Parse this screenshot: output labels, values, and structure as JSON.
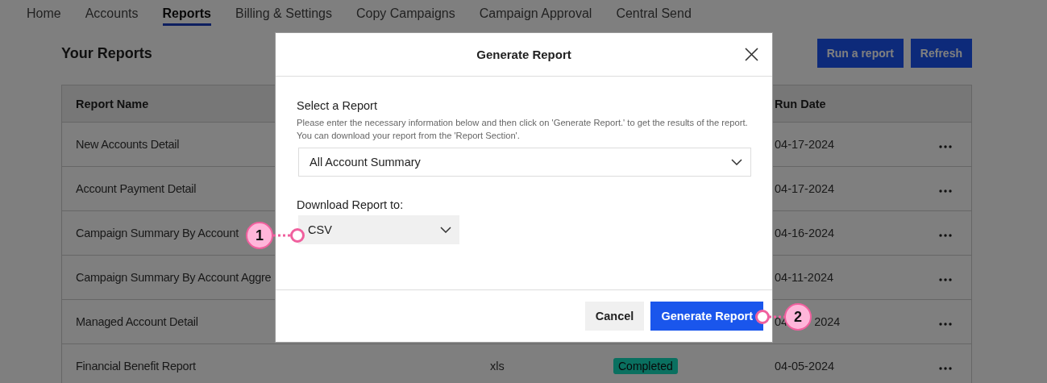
{
  "nav": {
    "tabs": [
      {
        "label": "Home",
        "selected": false
      },
      {
        "label": "Accounts",
        "selected": false
      },
      {
        "label": "Reports",
        "selected": true
      },
      {
        "label": "Billing & Settings",
        "selected": false
      },
      {
        "label": "Copy Campaigns",
        "selected": false
      },
      {
        "label": "Campaign Approval",
        "selected": false
      },
      {
        "label": "Central Send",
        "selected": false
      }
    ]
  },
  "page": {
    "title": "Your Reports",
    "buttons": [
      "Run a report",
      "Refresh"
    ]
  },
  "table": {
    "columns": [
      {
        "label": "Report Name",
        "kind": "name"
      },
      {
        "label": "Run Date",
        "kind": "run_date"
      }
    ],
    "rows": [
      {
        "name": "New Accounts Detail",
        "run_date": "04-17-2024"
      },
      {
        "name": "Account Payment Detail",
        "run_date": "04-17-2024"
      },
      {
        "name": "Campaign Summary By Account",
        "run_date": "04-16-2024"
      },
      {
        "name": "Campaign Summary By Account Aggre",
        "run_date": "04-11-2024"
      },
      {
        "name": "Managed Account Detail",
        "run_date": "04",
        "run_date_end": "2024"
      },
      {
        "name": "Financial Benefit Report",
        "column_2": "xls",
        "status": "Completed",
        "run_date": "04-05-2024"
      }
    ]
  },
  "dialog": {
    "title": "Generate Report",
    "fields": [
      {
        "kind": "wide",
        "label": "Select a Report",
        "help": "Please enter the necessary information below and then click on 'Generate Report.' to get the results of the report. You can download your report from the 'Report Section'.",
        "value": "All Account Summary"
      },
      {
        "kind": "compact",
        "label": "Download Report to:",
        "value": "CSV"
      }
    ],
    "buttons": [
      {
        "kind": "secondary",
        "label": "Cancel"
      },
      {
        "kind": "primary",
        "label": "Generate Report"
      }
    ]
  },
  "callouts": [
    {
      "label": "1"
    },
    {
      "label": "2"
    }
  ]
}
